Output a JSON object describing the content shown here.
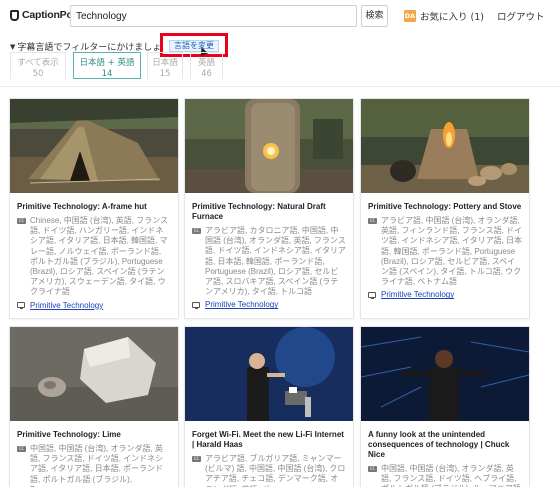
{
  "header": {
    "logo_text": "CaptionPop",
    "search_value": "Technology",
    "search_button": "検索",
    "favorites_badge": "DA",
    "favorites_label": "お気に入り (1)",
    "logout_label": "ログアウト"
  },
  "filter": {
    "label": "字幕言語でフィルターにかけましょう",
    "change_language_button": "言語を変更",
    "tabs": [
      {
        "label": "すべて表示",
        "count": "50",
        "active": false
      },
      {
        "label": "日本語 + 英語",
        "count": "14",
        "active": true
      },
      {
        "label": "日本語",
        "count": "15",
        "active": false
      },
      {
        "label": "英語",
        "count": "46",
        "active": false
      }
    ]
  },
  "cards": [
    {
      "title": "Primitive Technology: A-frame hut",
      "languages": "Chinese, 中国語 (台湾), 英語, フランス語, ドイツ語, ハンガリー語, インドネシア語, イタリア語, 日本語, 韓国語, マレー語, ノルウェイ語, ポーランド語, ポルトガル語 (ブラジル), Portuguese (Brazil), ロシア語, スペイン語 (ラテンアメリカ), スウェーデン語, タイ語, ウクライナ語",
      "channel": "Primitive Technology"
    },
    {
      "title": "Primitive Technology: Natural Draft Furnace",
      "languages": "アラビア語, カタロニア語, 中国語, 中国語 (台湾), オランダ語, 英語, フランス語, ドイツ語, インドネシア語, イタリア語, 日本語, 韓国語, ポーランド語, Portuguese (Brazil), ロシア語, セルビア語, スロバキア語, スペイン語 (ラテンアメリカ), タイ語, トルコ語",
      "channel": "Primitive Technology"
    },
    {
      "title": "Primitive Technology: Pottery and Stove",
      "languages": "アラビア語, 中国語 (台湾), オランダ語, 英語, フィンランド語, フランス語, ドイツ語, インドネシア語, イタリア語, 日本語, 韓国語, ポーランド語, Portuguese (Brazil), ロシア語, セルビア語, スペイン語 (スペイン), タイ語, トルコ語, ウクライナ語, ベトナム語",
      "channel": "Primitive Technology"
    },
    {
      "title": "Primitive Technology: Lime",
      "languages": "中国語, 中国語 (台湾), オランダ語, 英語, フランス語, ドイツ語, インドネシア語, イタリア語, 日本語, ポーランド語, ポルトガル語 (ブラジル), Portuguese",
      "channel": ""
    },
    {
      "title": "Forget Wi-Fi. Meet the new Li-Fi Internet | Harald Haas",
      "languages": "アラビア語, ブルガリア語, ミャンマー (ビルマ) 語, 中国語, 中国語 (台湾), クロアチア語, チェコ語, デンマーク語, オランダ語, 英語, ギ",
      "channel": ""
    },
    {
      "title": "A funny look at the unintended consequences of technology | Chuck Nice",
      "languages": "中国語, 中国語 (台湾), オランダ語, 英語, フランス語, ドイツ語, ヘブライ語, ポルトガル語 (ブラジル), ルーマニア語",
      "channel": ""
    }
  ],
  "colors": {
    "accent_teal": "#56b3b1",
    "highlight_red": "#e8001c",
    "link_blue": "#1a44b8",
    "badge_orange": "#f3a847"
  },
  "icons": {
    "logo": "bookmark-logo-icon",
    "captions": "cc-icon",
    "channel": "tv-icon"
  }
}
